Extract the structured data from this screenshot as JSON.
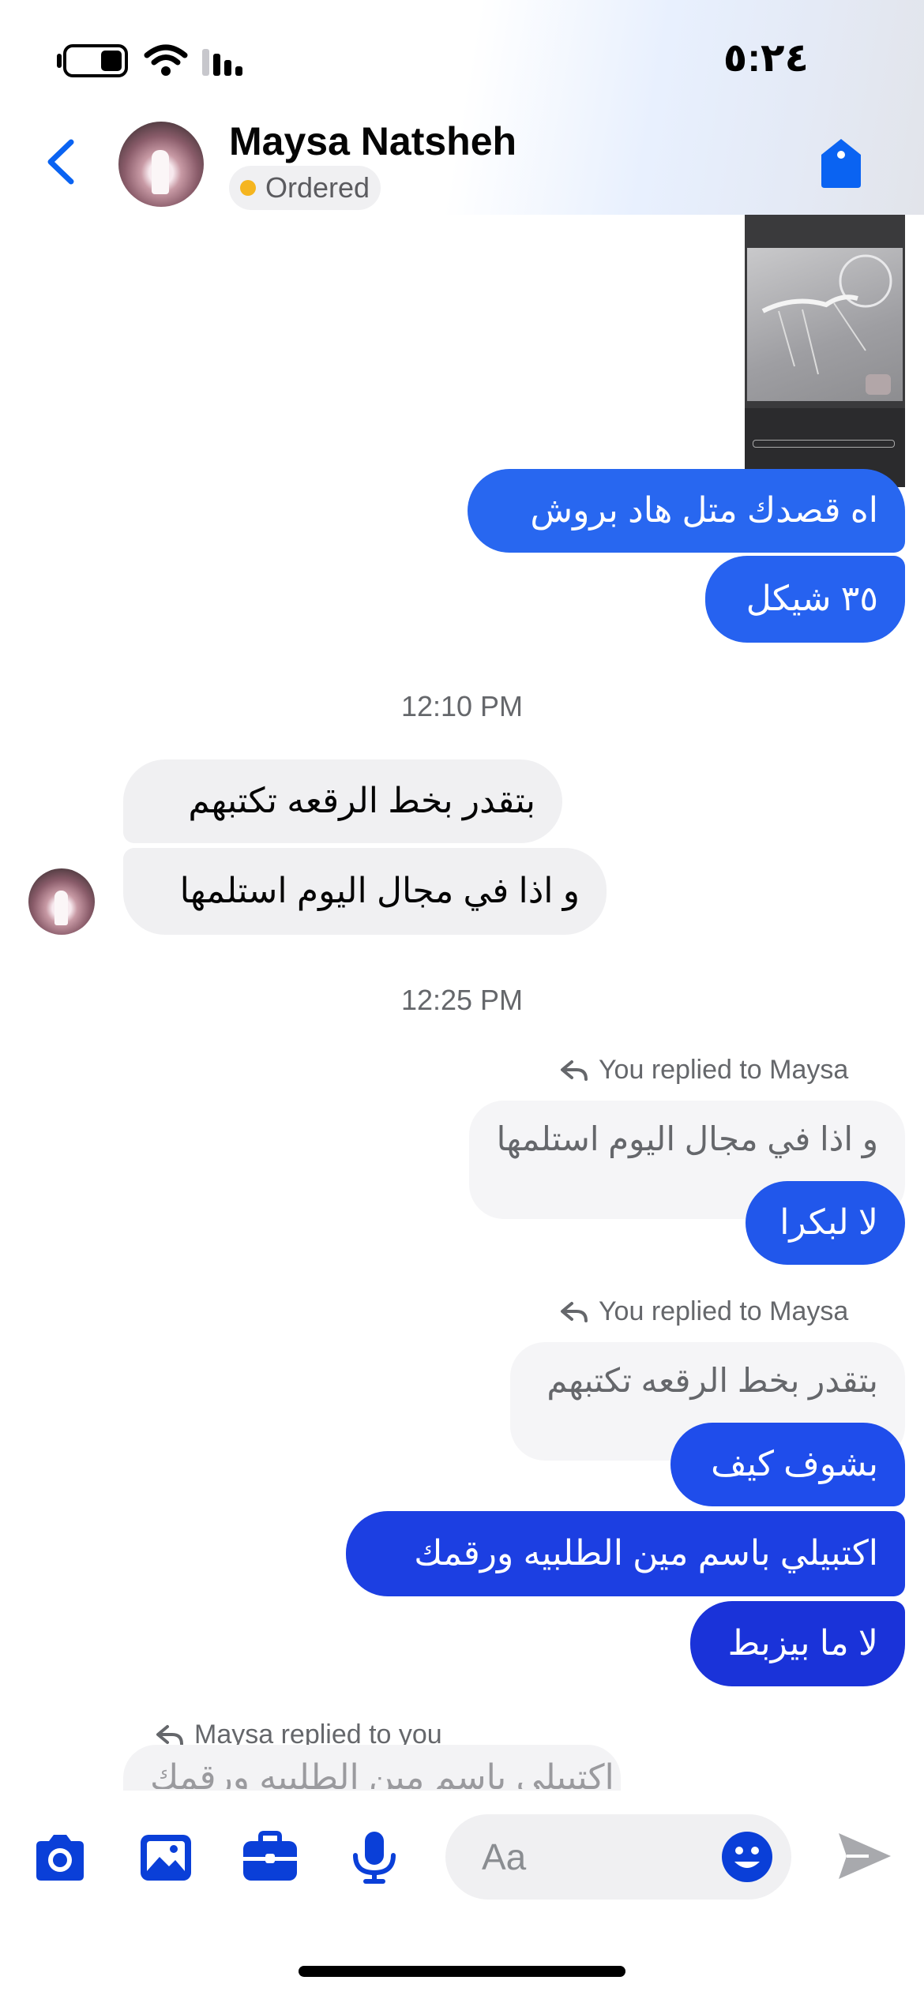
{
  "status_bar": {
    "time": "٥:٢٤"
  },
  "header": {
    "contact_name": "Maysa Natsheh",
    "status_label": "Ordered"
  },
  "messages": {
    "out_1": "اه قصدك متل هاد بروش",
    "out_2": "٣٥ شيكل",
    "time_1": "12:10 PM",
    "in_1": "بتقدر بخط الرقعه تكتبهم",
    "in_2": "و اذا في مجال اليوم استلمها",
    "time_2": "12:25 PM",
    "reply_label_1": "You replied to Maysa",
    "quote_1": "و اذا في مجال اليوم استلمها",
    "out_3": "لا لبكرا",
    "reply_label_2": "You replied to Maysa",
    "quote_2": "بتقدر بخط الرقعه تكتبهم",
    "out_4": "بشوف كيف",
    "out_5": "اكتبيلي باسم مين الطلبيه ورقمك",
    "out_6": "لا ما بيزبط",
    "reply_label_3": "Maysa replied to you",
    "quote_3_partial": "اكتبيلي باسم مين الطلبيه ورقمك"
  },
  "composer": {
    "placeholder": "Aa",
    "icons": [
      "camera-icon",
      "gallery-icon",
      "briefcase-icon",
      "microphone-icon",
      "emoji-icon",
      "send-icon"
    ]
  },
  "colors": {
    "accent": "#0a4fe6",
    "bubble_blue_top": "#2a5cf0",
    "bubble_blue_bottom": "#1a2fd6",
    "incoming_bubble": "#f0f0f2",
    "status_dot": "#f5b51f"
  }
}
